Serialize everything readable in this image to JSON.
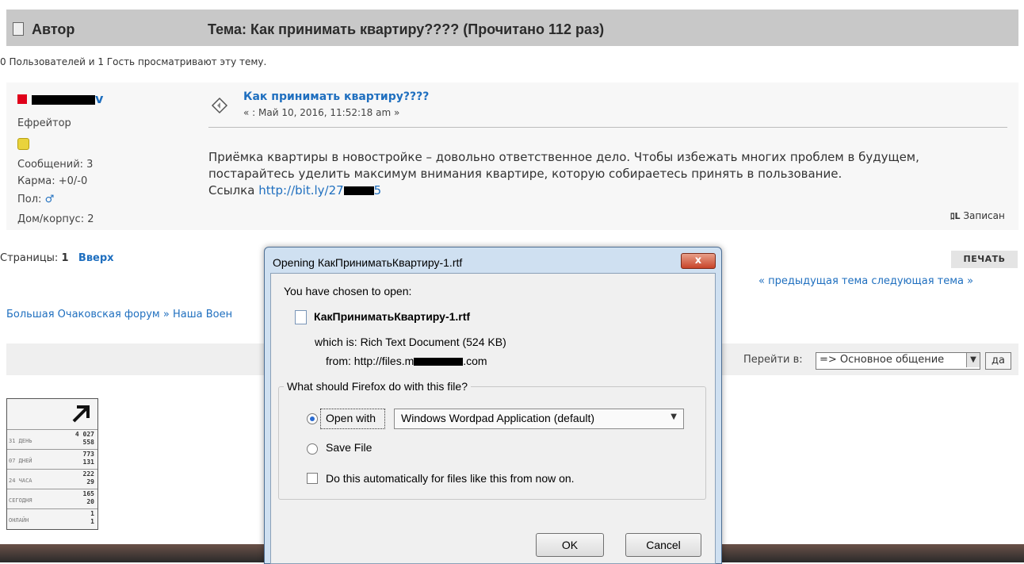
{
  "header": {
    "author_label": "Автор",
    "topic_title": "Тема: Как принимать квартиру????  (Прочитано 112 раз)"
  },
  "viewers_text": "0 Пользователей и 1 Гость просматривают эту тему.",
  "post": {
    "user_name_visible": "v",
    "user_rank": "Ефрейтор",
    "messages": "Сообщений: 3",
    "karma": "Карма: +0/-0",
    "gender_label": "Пол:",
    "gender_symbol": "♂",
    "house": "Дом/корпус: 2",
    "title": "Как принимать квартиру????",
    "date": "« : Май 10, 2016, 11:52:18 am »",
    "body_line1": "Приёмка квартиры в новостройке – довольно ответственное дело. Чтобы избежать многих проблем в будущем,",
    "body_line2": "постарайтесь уделить максимум внимания квартире, которую собираетесь принять в пользование.",
    "link_label": "Ссылка",
    "link_url_visible": "http://bit.ly/27",
    "link_url_tail": "5",
    "recorded_label": "Записан"
  },
  "nav": {
    "pages_label": "Страницы:",
    "pages_current": "1",
    "top_link": "Вверх",
    "print_button": "ПЕЧАТЬ",
    "prev_topic": "« предыдущая тема",
    "next_topic": "следующая тема »",
    "breadcrumb": "Большая Очаковская форум » Наша Воен"
  },
  "jump": {
    "label": "Перейти в:",
    "selected": "=> Основное общение",
    "go_button": "да"
  },
  "counter": {
    "rows": [
      {
        "label": "31 ДЕНЬ",
        "top": "4 027",
        "bottom": "558"
      },
      {
        "label": "07 ДНЕЙ",
        "top": "773",
        "bottom": "131"
      },
      {
        "label": "24 ЧАСА",
        "top": "222",
        "bottom": "29"
      },
      {
        "label": "СЕГОДНЯ",
        "top": "165",
        "bottom": "20"
      },
      {
        "label": "ОНЛАЙН",
        "top": "1",
        "bottom": "1"
      }
    ]
  },
  "dialog": {
    "title": "Opening КакПриниматьКвартиру-1.rtf",
    "close_label": "x",
    "chosen_text": "You have chosen to open:",
    "file_name": "КакПриниматьКвартиру-1.rtf",
    "which_label": "which is:",
    "which_value": "Rich Text Document (524 KB)",
    "from_label": "from:",
    "from_prefix": "http://files.m",
    "from_suffix": ".com",
    "question": "What should Firefox do with this file?",
    "open_with_label": "Open with",
    "open_with_app": "Windows Wordpad Application (default)",
    "save_file_label": "Save File",
    "auto_checkbox_label": "Do this automatically for files like this from now on.",
    "ok_button": "OK",
    "cancel_button": "Cancel"
  }
}
